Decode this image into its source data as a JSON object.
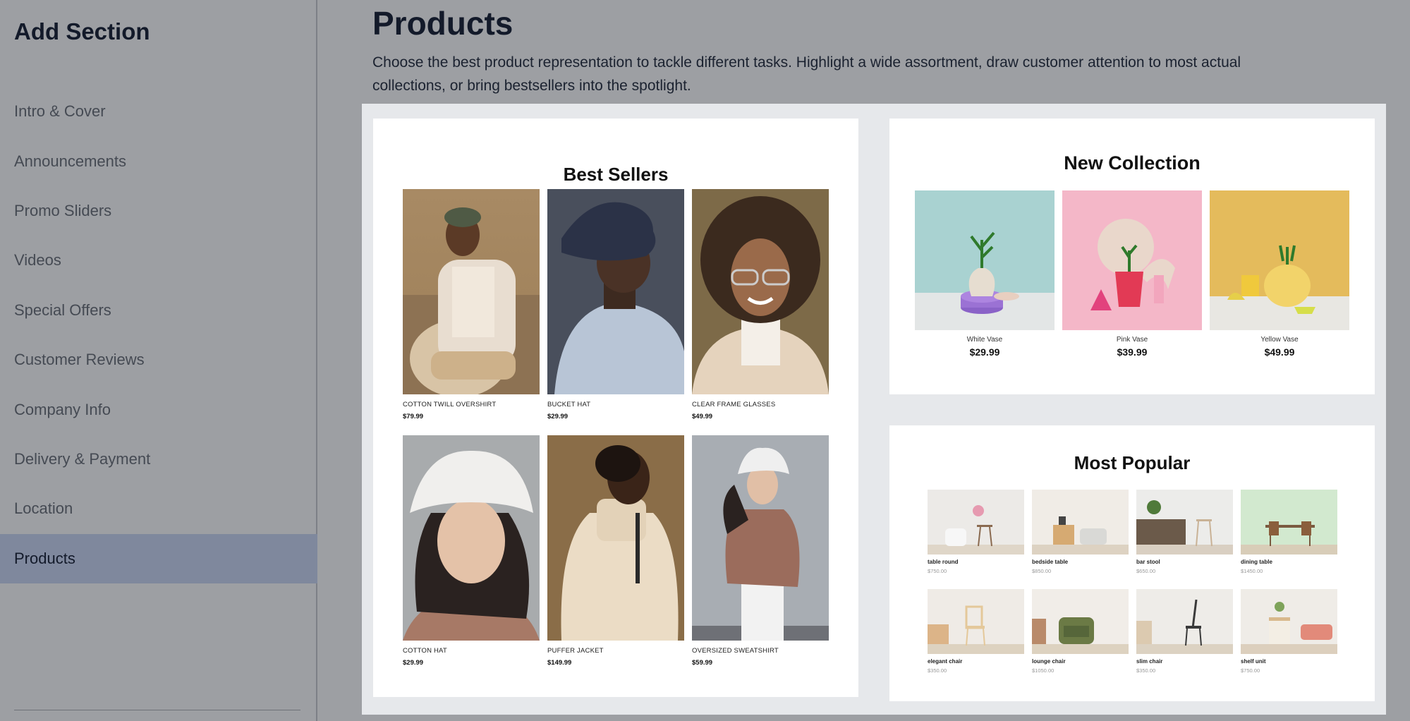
{
  "sidebar": {
    "title": "Add Section",
    "items": [
      {
        "label": "Intro & Cover"
      },
      {
        "label": "Announcements"
      },
      {
        "label": "Promo Sliders"
      },
      {
        "label": "Videos"
      },
      {
        "label": "Special Offers"
      },
      {
        "label": "Customer Reviews"
      },
      {
        "label": "Company Info"
      },
      {
        "label": "Delivery & Payment"
      },
      {
        "label": "Location"
      },
      {
        "label": "Products",
        "active": true
      }
    ]
  },
  "main": {
    "title": "Products",
    "description": "Choose the best product representation to tackle different tasks. Highlight a wide assortment, draw customer attention to most actual collections, or bring bestsellers into the spotlight."
  },
  "best_sellers": {
    "title": "Best Sellers",
    "items": [
      {
        "name": "COTTON TWILL OVERSHIRT",
        "price": "$79.99"
      },
      {
        "name": "BUCKET HAT",
        "price": "$29.99"
      },
      {
        "name": "CLEAR FRAME GLASSES",
        "price": "$49.99"
      },
      {
        "name": "COTTON HAT",
        "price": "$29.99"
      },
      {
        "name": "PUFFER JACKET",
        "price": "$149.99"
      },
      {
        "name": "OVERSIZED SWEATSHIRT",
        "price": "$59.99"
      }
    ]
  },
  "new_collection": {
    "title": "New Collection",
    "items": [
      {
        "name": "White Vase",
        "price": "$29.99"
      },
      {
        "name": "Pink Vase",
        "price": "$39.99"
      },
      {
        "name": "Yellow Vase",
        "price": "$49.99"
      }
    ]
  },
  "most_popular": {
    "title": "Most Popular",
    "items": [
      {
        "name": "table round",
        "price": "$750.00"
      },
      {
        "name": "bedside table",
        "price": "$850.00"
      },
      {
        "name": "bar stool",
        "price": "$650.00"
      },
      {
        "name": "dining table",
        "price": "$1450.00"
      },
      {
        "name": "elegant chair",
        "price": "$350.00"
      },
      {
        "name": "lounge chair",
        "price": "$1050.00"
      },
      {
        "name": "slim chair",
        "price": "$350.00"
      },
      {
        "name": "shelf unit",
        "price": "$750.00"
      }
    ]
  },
  "colors": {
    "background": "#9d9fa3",
    "active_item": "#7f889d",
    "preview_bg": "#e6e8eb"
  }
}
